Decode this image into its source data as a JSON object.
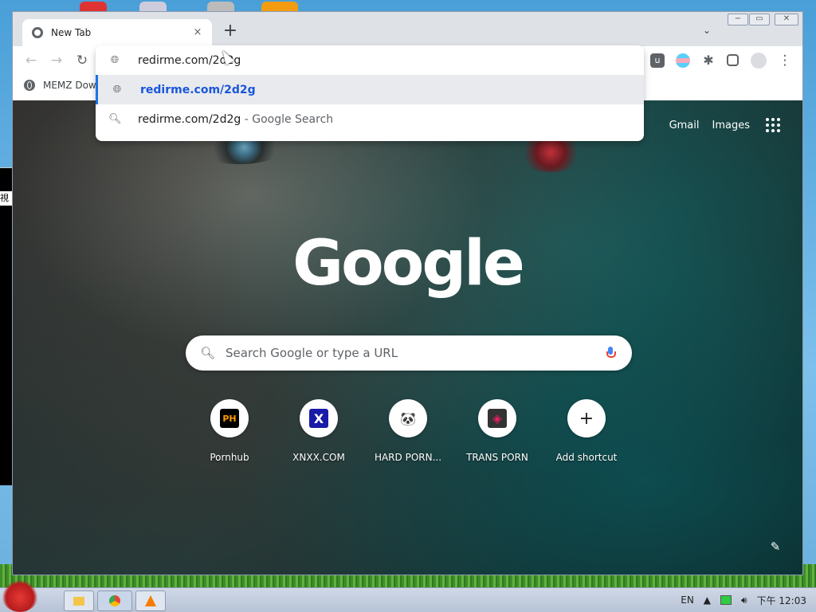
{
  "browser": {
    "tab_title": "New Tab",
    "tab_close": "×",
    "new_tab": "+",
    "tab_list": "⌄"
  },
  "window_controls": {
    "minimize": "−",
    "maximize": "▭",
    "close": "✕"
  },
  "toolbar": {
    "back": "←",
    "forward": "→",
    "reload": "↻"
  },
  "bookmarks": {
    "items": [
      {
        "label": "MEMZ Dow"
      }
    ]
  },
  "omnibox": {
    "input": "redirme.com/2d2g",
    "suggestions": [
      {
        "text": "redirme.com/2d2g",
        "hint": "",
        "selected": true
      },
      {
        "text": "redirme.com/2d2g",
        "hint": " - Google Search",
        "selected": false
      }
    ]
  },
  "newtab_page": {
    "links": {
      "gmail": "Gmail",
      "images": "Images"
    },
    "logo": "Google",
    "search_placeholder": "Search Google or type a URL",
    "shortcuts": [
      {
        "label": "Pornhub",
        "icon": "PH"
      },
      {
        "label": "XNXX.COM",
        "icon": "X"
      },
      {
        "label": "HARD PORN...",
        "icon": "🐼"
      },
      {
        "label": "TRANS PORN",
        "icon": "◈"
      },
      {
        "label": "Add shortcut",
        "icon": "+"
      }
    ],
    "customize_icon": "✎"
  },
  "taskbar": {
    "tray": {
      "lang": "EN",
      "time": "下午 12:03"
    }
  },
  "desktop": {
    "side_text": "視"
  },
  "colors": {
    "accent": "#1a73e8",
    "selected_row": "#e8eaed"
  }
}
